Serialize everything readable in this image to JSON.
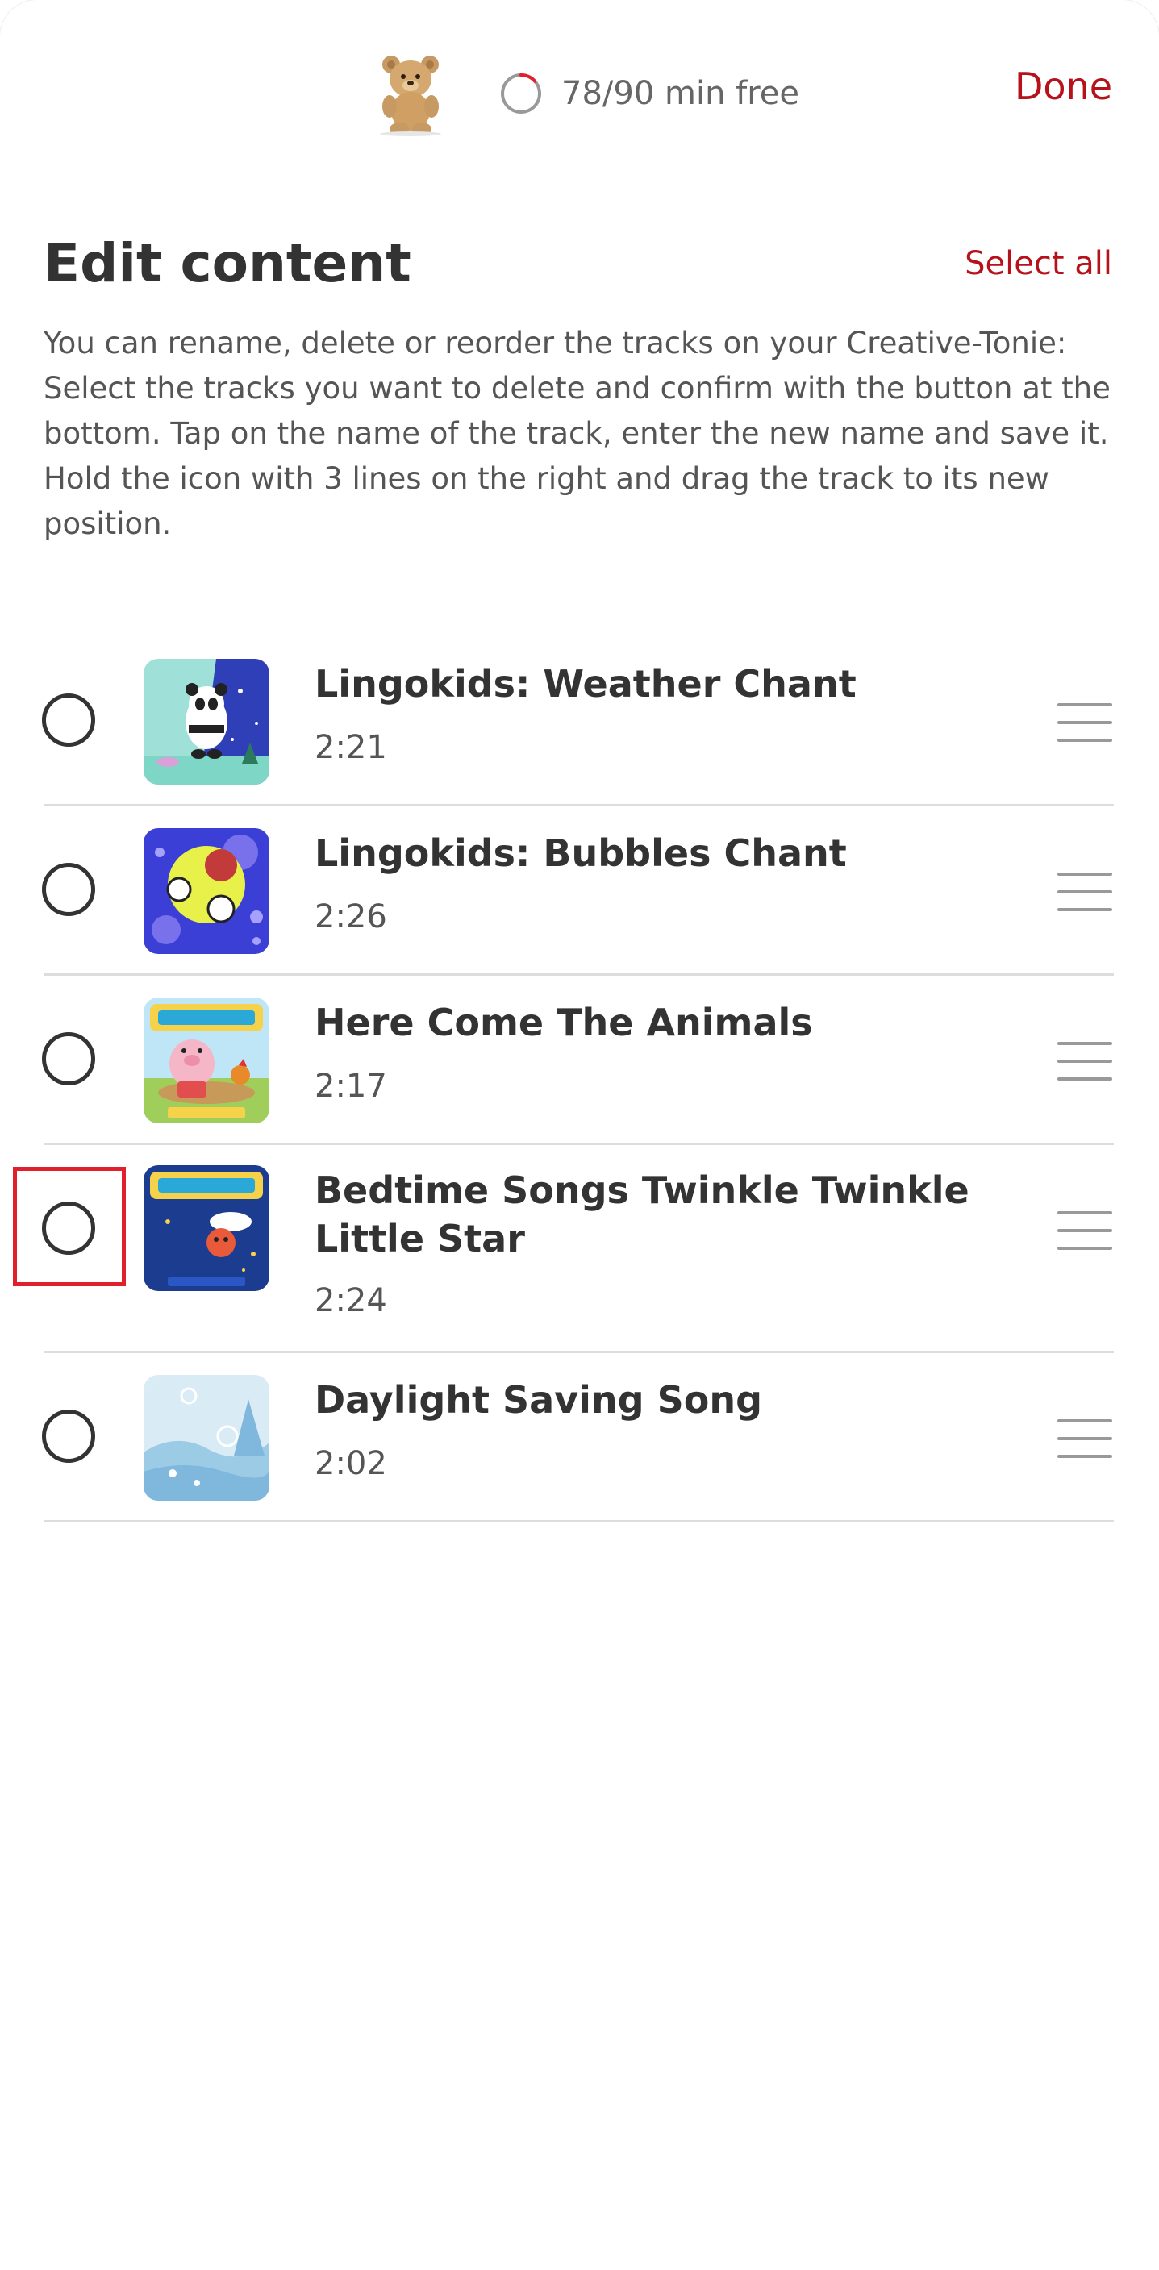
{
  "header": {
    "capacity_text": "78/90 min free",
    "capacity_fraction_used": 0.133,
    "done_label": "Done"
  },
  "page": {
    "title": "Edit content",
    "select_all_label": "Select all",
    "description": "You can rename, delete or reorder the tracks on your Creative-Tonie: Select the tracks you want to delete and confirm with the button at the bottom. Tap on the name of the track, enter the new name and save it. Hold the icon with 3 lines on the right and drag the track to its new position."
  },
  "tracks": [
    {
      "title": "Lingokids: Weather Chant",
      "duration": "2:21",
      "cover": "panda-cover"
    },
    {
      "title": "Lingokids: Bubbles Chant",
      "duration": "2:26",
      "cover": "bubbles-cover"
    },
    {
      "title": "Here Come The Animals",
      "duration": "2:17",
      "cover": "animal-songs-cover"
    },
    {
      "title": "Bedtime Songs Twinkle Twinkle Little Star",
      "duration": "2:24",
      "cover": "bedtime-songs-cover"
    },
    {
      "title": "Daylight Saving Song",
      "duration": "2:02",
      "cover": "daylight-cover"
    }
  ],
  "colors": {
    "accent": "#b5121b",
    "highlight": "#e0212d",
    "text": "#333333"
  }
}
